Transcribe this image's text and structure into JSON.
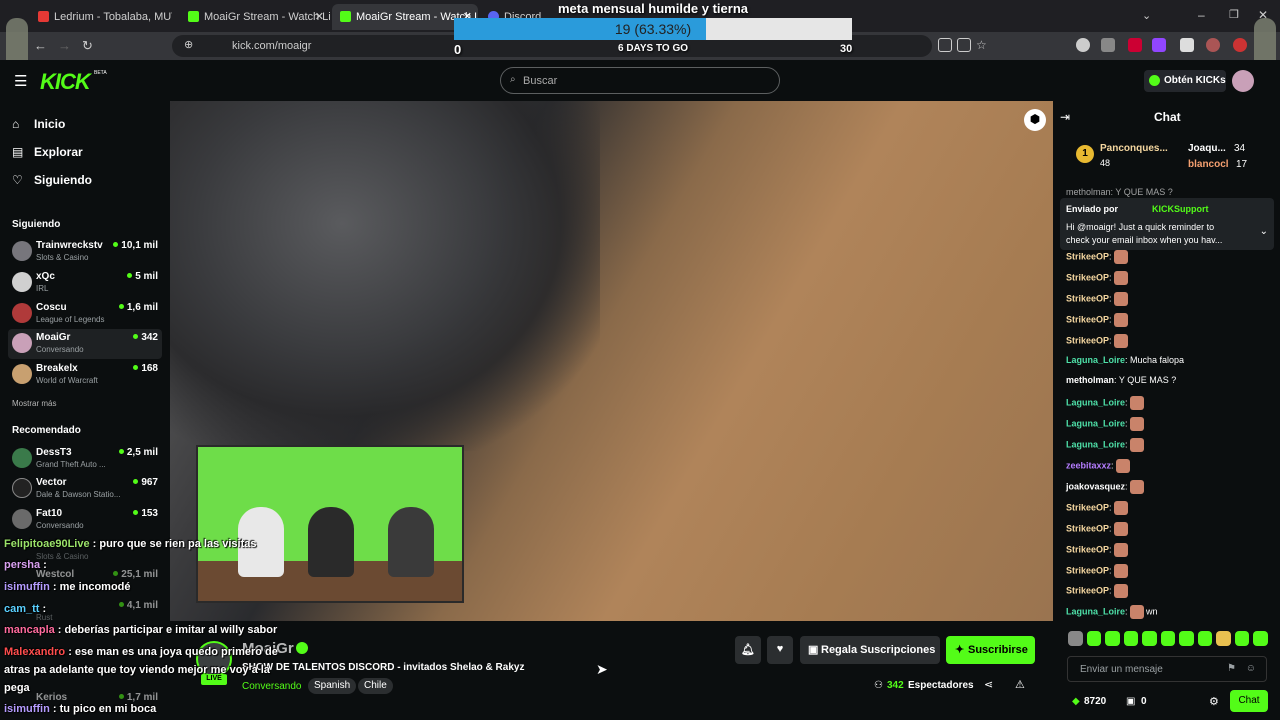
{
  "browser": {
    "tabs": [
      {
        "title": "Ledrium - Tobalaba, MUT, Av. P",
        "color": "#e53935"
      },
      {
        "title": "MoaiGr Stream - Watch Live on",
        "color": "#53fc18"
      },
      {
        "title": "MoaiGr Stream - Watch Li",
        "color": "#53fc18"
      },
      {
        "title": "Discord",
        "color": "#5865f2"
      }
    ],
    "url": "kick.com/moaigr"
  },
  "goal": {
    "title": "meta mensual humilde y tierna",
    "progress_text": "19 (63.33%)",
    "progress": 0.6333,
    "min": "0",
    "max": "30",
    "days_left": "6 DAYS TO GO"
  },
  "header": {
    "logo": "KICK",
    "beta": "BETA",
    "search_placeholder": "Buscar",
    "kicks_button": "Obtén KICKs"
  },
  "sidebar": {
    "nav": [
      {
        "label": "Inicio",
        "icon": "home-icon"
      },
      {
        "label": "Explorar",
        "icon": "browse-icon"
      },
      {
        "label": "Siguiendo",
        "icon": "heart-icon"
      }
    ],
    "following_title": "Siguiendo",
    "following": [
      {
        "name": "Trainwreckstv",
        "game": "Slots & Casino",
        "viewers": "10,1 mil"
      },
      {
        "name": "xQc",
        "game": "IRL",
        "viewers": "5 mil"
      },
      {
        "name": "Coscu",
        "game": "League of Legends",
        "viewers": "1,6 mil"
      },
      {
        "name": "MoaiGr",
        "game": "Conversando",
        "viewers": "342"
      },
      {
        "name": "Breakelx",
        "game": "World of Warcraft",
        "viewers": "168"
      }
    ],
    "show_more": "Mostrar más",
    "recommended_title": "Recomendado",
    "recommended": [
      {
        "name": "DessT3",
        "game": "Grand Theft Auto ...",
        "viewers": "2,5 mil"
      },
      {
        "name": "Vector",
        "game": "Dale & Dawson Statio...",
        "viewers": "967"
      },
      {
        "name": "Fat10",
        "game": "Conversando",
        "viewers": "153"
      },
      {
        "name": "Westcol",
        "game": "Slots & Casino",
        "viewers": "25,1 mil"
      },
      {
        "name": "...",
        "game": "Rust",
        "viewers": "4,1 mil"
      },
      {
        "name": "Kerios",
        "game": "",
        "viewers": "1,7 mil"
      }
    ]
  },
  "overlay_chat": [
    {
      "user": "Felipitoae90Live",
      "text": " : puro que se rien pa las visitas",
      "color": "#9be36a"
    },
    {
      "user": "persha",
      "text": " :",
      "color": "#d9a0f0"
    },
    {
      "user": "isimuffin",
      "text": " : me incomodé",
      "color": "#b59cff"
    },
    {
      "user": "cam_tt",
      "text": " :",
      "color": "#5ad0ff"
    },
    {
      "user": "mancapla",
      "text": " : deberías participar e imitar al willy sabor",
      "color": "#ff6b9e"
    },
    {
      "user": "Malexandro",
      "text": " : ese man es una joya quedo primero de",
      "color": "#ff4d4d"
    },
    {
      "user": "",
      "text": "atras pa adelante    que toy viendo mejor me voy a la",
      "color": "#ffffff"
    },
    {
      "user": "",
      "text": "pega",
      "color": "#ffffff"
    },
    {
      "user": "isimuffin",
      "text": " : tu pico en mi boca",
      "color": "#b59cff"
    }
  ],
  "stream": {
    "streamer": "MoaiGr",
    "title": "SHOW DE TALENTOS DISCORD - invitados Shelao & Rakyz",
    "category": "Conversando",
    "tags": [
      "Spanish",
      "Chile"
    ],
    "viewers": "342",
    "viewers_label": "Espectadores",
    "gift_button": "Regala Suscripciones",
    "subscribe_button": "Suscribirse",
    "live_badge": "LIVE"
  },
  "chat": {
    "title": "Chat",
    "leaderboard": [
      {
        "rank": "1",
        "name": "Panconques...",
        "value": "48"
      },
      {
        "name": "Joaqu...",
        "value": "34"
      },
      {
        "name": "blancocl",
        "value": "17"
      }
    ],
    "pinned": {
      "label": "Enviado por",
      "sender": "KICKSupport",
      "text1": "Hi @moaigr! Just a quick reminder to",
      "text2": "check your email inbox when you hav..."
    },
    "top_partial": "metholman: Y QUE MAS ?",
    "messages": [
      {
        "user": "StrikeeOP",
        "text": "",
        "color": "#f5d7a0",
        "emote": true
      },
      {
        "user": "StrikeeOP",
        "text": "",
        "color": "#f5d7a0",
        "emote": true
      },
      {
        "user": "StrikeeOP",
        "text": "",
        "color": "#f5d7a0",
        "emote": true
      },
      {
        "user": "StrikeeOP",
        "text": "",
        "color": "#f5d7a0",
        "emote": true
      },
      {
        "user": "StrikeeOP",
        "text": "",
        "color": "#f5d7a0",
        "emote": true
      },
      {
        "user": "Laguna_Loire",
        "text": " Mucha falopa",
        "color": "#4ee0a8",
        "emote": false
      },
      {
        "user": "metholman",
        "text": " Y QUE MAS ?",
        "color": "#ffffff",
        "emote": false
      },
      {
        "user": "Laguna_Loire",
        "text": "",
        "color": "#4ee0a8",
        "emote": true
      },
      {
        "user": "Laguna_Loire",
        "text": "",
        "color": "#4ee0a8",
        "emote": true
      },
      {
        "user": "Laguna_Loire",
        "text": "",
        "color": "#4ee0a8",
        "emote": true
      },
      {
        "user": "zeebitaxxz",
        "text": "",
        "color": "#b57dff",
        "emote": true
      },
      {
        "user": "joakovasquez",
        "text": "",
        "color": "#ffffff",
        "emote": true
      },
      {
        "user": "StrikeeOP",
        "text": "",
        "color": "#f5d7a0",
        "emote": true
      },
      {
        "user": "StrikeeOP",
        "text": "",
        "color": "#f5d7a0",
        "emote": true
      },
      {
        "user": "StrikeeOP",
        "text": "",
        "color": "#f5d7a0",
        "emote": true
      },
      {
        "user": "StrikeeOP",
        "text": "",
        "color": "#f5d7a0",
        "emote": true
      },
      {
        "user": "StrikeeOP",
        "text": "",
        "color": "#f5d7a0",
        "emote": true
      },
      {
        "user": "Laguna_Loire",
        "text": " wn",
        "color": "#4ee0a8",
        "emote": true
      }
    ],
    "input_placeholder": "Enviar un mensaje",
    "kicks_balance": "8720",
    "gift_count": "0",
    "send_button": "Chat"
  },
  "colors": {
    "accent": "#53fc18",
    "bg": "#0b0e0f",
    "goal_fill": "#2a9bdb"
  }
}
